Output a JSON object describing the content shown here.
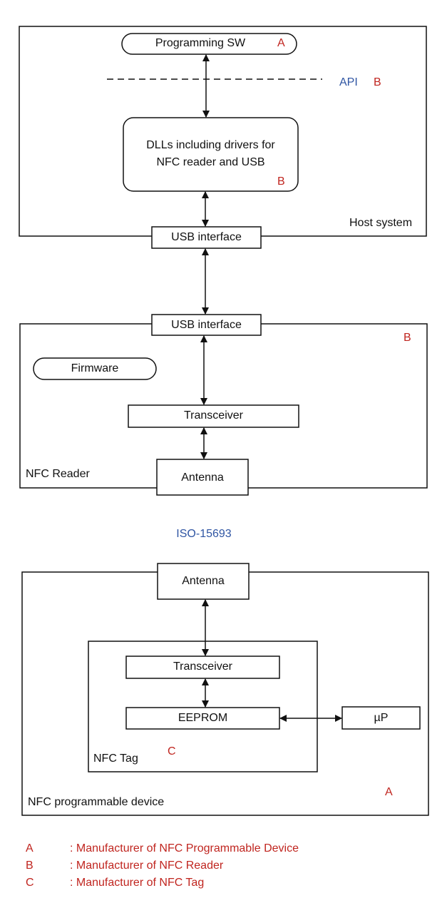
{
  "diagram": {
    "host_system": {
      "label": "Host system",
      "programming_sw": {
        "label": "Programming SW",
        "tag": "A"
      },
      "api": {
        "label": "API",
        "tag": "B"
      },
      "dlls": {
        "line1": "DLLs including drivers for",
        "line2": "NFC reader and USB",
        "tag": "B"
      },
      "usb_interface": "USB interface"
    },
    "nfc_reader": {
      "label": "NFC Reader",
      "tag": "B",
      "usb_interface": "USB interface",
      "firmware": "Firmware",
      "transceiver": "Transceiver",
      "antenna": "Antenna"
    },
    "protocol": "ISO-15693",
    "nfc_programmable_device": {
      "label": "NFC programmable device",
      "tag": "A",
      "antenna": "Antenna",
      "nfc_tag": {
        "label": "NFC Tag",
        "tag": "C",
        "transceiver": "Transceiver",
        "eeprom": "EEPROM"
      },
      "microprocessor": "µP"
    }
  },
  "legend": [
    {
      "key": "A",
      "text": ": Manufacturer of NFC Programmable Device"
    },
    {
      "key": "B",
      "text": ": Manufacturer of NFC Reader"
    },
    {
      "key": "C",
      "text": ": Manufacturer of NFC Tag"
    }
  ],
  "colors": {
    "tag_red": "#c0251f",
    "label_blue": "#2f55a3",
    "line": "#111111"
  }
}
